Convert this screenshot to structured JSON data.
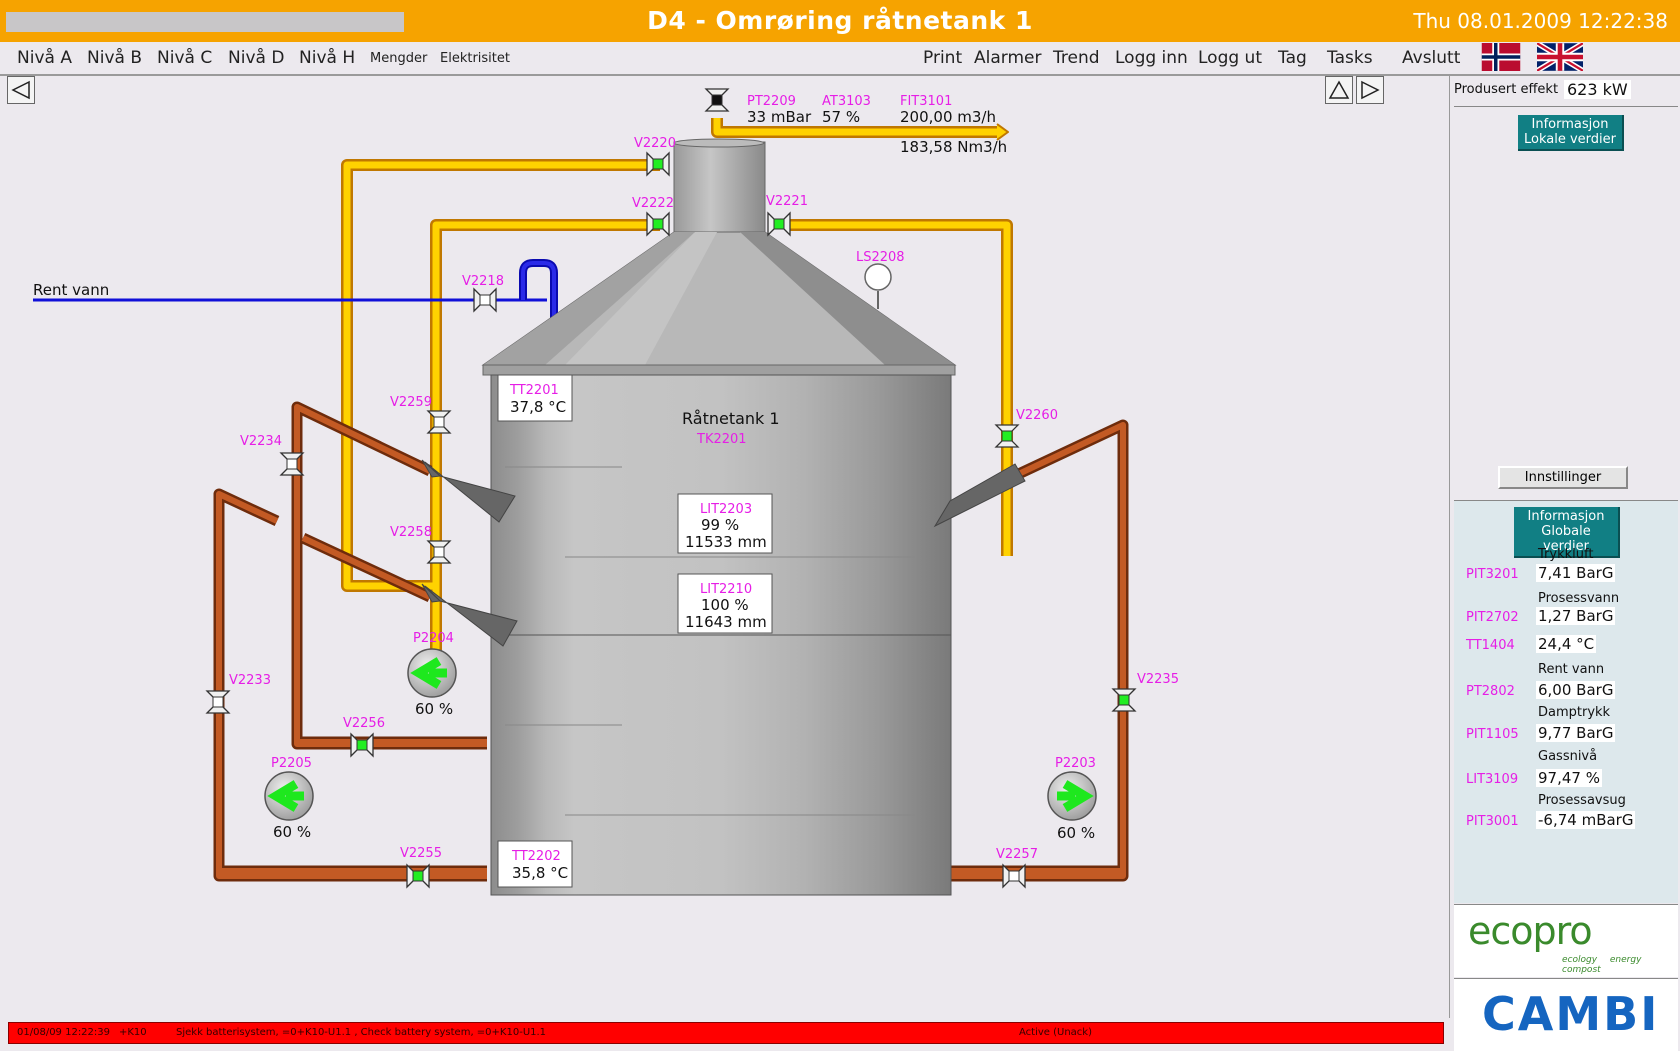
{
  "titlebar": {
    "title": "D4 - Omrøring råtnetank 1",
    "clock": "Thu 08.01.2009 12:22:38"
  },
  "menu": {
    "left": [
      "Nivå A",
      "Nivå B",
      "Nivå C",
      "Nivå D",
      "Nivå H",
      "Mengder",
      "Elektrisitet"
    ],
    "right": [
      "Print",
      "Alarmer",
      "Trend",
      "Logg inn",
      "Logg ut",
      "Tag",
      "Tasks",
      "Avslutt"
    ]
  },
  "colors": {
    "gas_pipe": "#f6a300",
    "sludge_pipe": "#b04a1c",
    "water_pipe": "#1010d8",
    "valve_open": "#22ee22",
    "tag_label": "#e61ee6",
    "titlebar": "#f6a300",
    "alarm": "#ff0000"
  },
  "process": {
    "tank_name": "Råtnetank 1",
    "tank_tag": "TK2201",
    "water_line": "Rent vann",
    "valves": [
      "V2220",
      "V2222",
      "V2221",
      "V2218",
      "V2259",
      "V2258",
      "V2260",
      "V2234",
      "V2233",
      "V2256",
      "V2235",
      "V2255",
      "V2257"
    ],
    "gas": {
      "pt2209": {
        "tag": "PT2209",
        "value": "33 mBar"
      },
      "at3103": {
        "tag": "AT3103",
        "value": "57 %"
      },
      "fit3101": {
        "tag": "FIT3101",
        "value": "200,00 m3/h",
        "value2": "183,58 Nm3/h"
      }
    },
    "ls2208": "LS2208",
    "tt2201": {
      "tag": "TT2201",
      "value": "37,8 °C"
    },
    "tt2202": {
      "tag": "TT2202",
      "value": "35,8 °C"
    },
    "lit2203": {
      "tag": "LIT2203",
      "pct": "99 %",
      "mm": "11533 mm"
    },
    "lit2210": {
      "tag": "LIT2210",
      "pct": "100 %",
      "mm": "11643 mm"
    },
    "p2204": {
      "tag": "P2204",
      "speed": "60 %"
    },
    "p2205": {
      "tag": "P2205",
      "speed": "60 %"
    },
    "p2203": {
      "tag": "P2203",
      "speed": "60 %"
    }
  },
  "right_panel": {
    "produced_label": "Produsert effekt",
    "produced_value": "623 kW",
    "local_button": "Informasjon Lokale verdier",
    "settings_button": "Innstillinger",
    "global_button": "Informasjon Globale verdier",
    "globals": [
      {
        "title": "Trykkluft",
        "tag": "PIT3201",
        "value": "7,41 BarG"
      },
      {
        "title": "Prosessvann",
        "tag": "PIT2702",
        "value": "1,27 BarG"
      },
      {
        "title": "",
        "tag": "TT1404",
        "value": "24,4 °C"
      },
      {
        "title": "Rent vann",
        "tag": "PT2802",
        "value": "6,00 BarG"
      },
      {
        "title": "Damptrykk",
        "tag": "PIT1105",
        "value": "9,77 BarG"
      },
      {
        "title": "Gassnivå",
        "tag": "LIT3109",
        "value": "97,47 %"
      },
      {
        "title": "Prosessavsug",
        "tag": "PIT3001",
        "value": "-6,74 mBarG"
      }
    ],
    "logo1": "ecopro",
    "logo1_tagline": "ecology energy compost",
    "logo2": "CAMBI"
  },
  "alarm": {
    "time": "01/08/09 12:22:39",
    "code": "+K10",
    "text": "Sjekk batterisystem, =0+K10-U1.1 , Check battery system, =0+K10-U1.1",
    "state": "Active (Unack)"
  }
}
